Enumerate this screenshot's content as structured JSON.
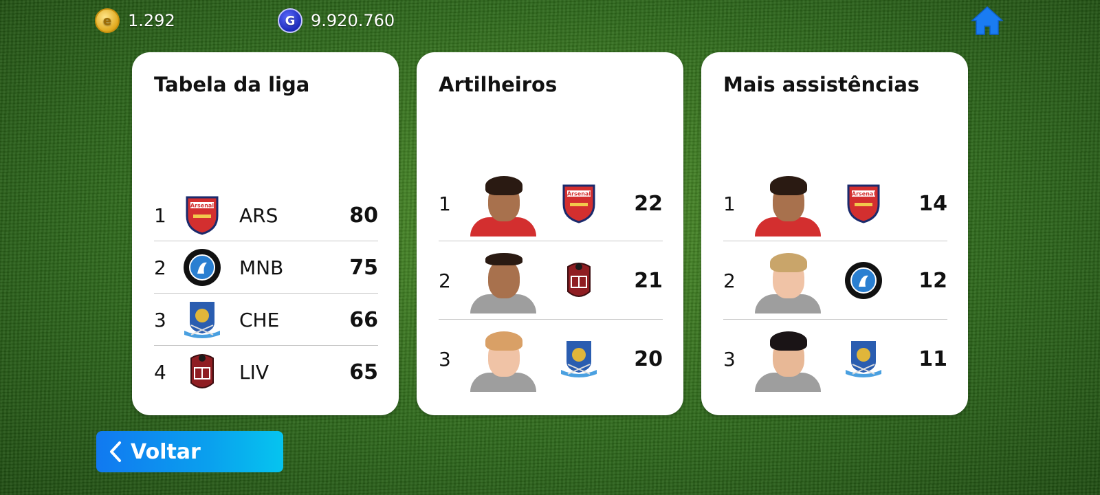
{
  "hud": {
    "ecoin_value": "1.292",
    "gp_value": "9.920.760",
    "ecoin_icon": "e-coin-icon",
    "gp_icon": "gp-coin-icon",
    "home_icon": "home-icon"
  },
  "league_table": {
    "title": "Tabela da liga",
    "rows": [
      {
        "rank": "1",
        "club": "ARS",
        "crest": "arsenal-crest",
        "points": "80"
      },
      {
        "rank": "2",
        "club": "MNB",
        "crest": "mab-crest",
        "points": "75"
      },
      {
        "rank": "3",
        "club": "CHE",
        "crest": "bulldog-crest",
        "points": "66"
      },
      {
        "rank": "4",
        "club": "LIV",
        "crest": "edc-crest",
        "points": "65"
      }
    ]
  },
  "top_scorers": {
    "title": "Artilheiros",
    "rows": [
      {
        "rank": "1",
        "crest": "arsenal-crest",
        "goals": "22"
      },
      {
        "rank": "2",
        "crest": "edc-crest",
        "goals": "21"
      },
      {
        "rank": "3",
        "crest": "bulldog-crest",
        "goals": "20"
      }
    ]
  },
  "top_assists": {
    "title": "Mais assistências",
    "rows": [
      {
        "rank": "1",
        "crest": "arsenal-crest",
        "assists": "14"
      },
      {
        "rank": "2",
        "crest": "mab-crest",
        "assists": "12"
      },
      {
        "rank": "3",
        "crest": "bulldog-crest",
        "assists": "11"
      }
    ]
  },
  "back_button": {
    "label": "Voltar",
    "icon": "chevron-left-icon"
  },
  "colors": {
    "accent_blue": "#1179f0",
    "arsenal_red": "#d32f2f",
    "card_bg": "#ffffff"
  }
}
